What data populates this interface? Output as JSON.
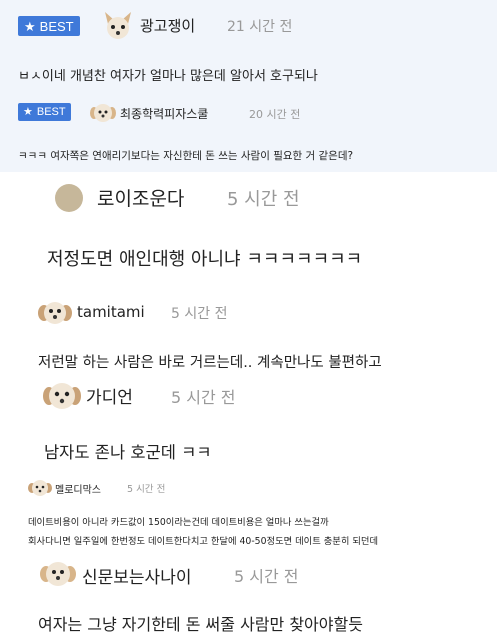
{
  "comments": [
    {
      "badge": "BEST",
      "author": "광고쟁이",
      "time": "21 시간 전",
      "text": "ㅂㅅ이네 개념찬 여자가 얼마나 많은데 알아서 호구되나"
    },
    {
      "badge": "BEST",
      "author": "최종학력피자스쿨",
      "time": "20 시간 전",
      "text": "ㅋㅋㅋ 여자쪽은 연애리기보다는 자신한테 돈 쓰는 사람이 필요한 거 같은데?"
    },
    {
      "author": "로이조운다",
      "time": "5 시간 전",
      "text": "저정도면 애인대행 아니냐 ㅋㅋㅋㅋㅋㅋㅋ"
    },
    {
      "author": "tamitami",
      "time": "5 시간 전",
      "text": "저런말 하는 사람은 바로 거르는데.. 계속만나도 불편하고"
    },
    {
      "author": "가디언",
      "time": "5 시간 전",
      "text": "남자도 존나 호군데 ㅋㅋ"
    },
    {
      "author": "멜로디막스",
      "time": "5 시간 전",
      "text_line1": "데이트비용이 아니라 카드값이 150이라는건데 데이트비용은 얼마나 쓰는걸까",
      "text_line2": "회사다니면 일주일에 한번정도 데이트한다치고 한달에 40-50정도면 데이트 충분히 되던데"
    },
    {
      "author": "신문보는사나이",
      "time": "5 시간 전",
      "text": "여자는 그냥 자기한테 돈 써줄 사람만 찾아야할듯"
    }
  ],
  "colors": {
    "best_badge": "#3f79d9",
    "time": "#999999",
    "top_panel": "#f1f5fb"
  }
}
